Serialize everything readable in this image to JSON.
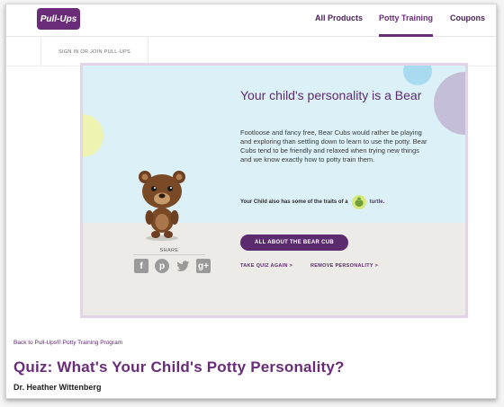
{
  "header": {
    "logo_text": "Pull-Ups",
    "nav": [
      "All Products",
      "Potty Training",
      "Coupons"
    ],
    "active_nav": "Potty Training",
    "signin_label": "SIGN IN OR JOIN PULL-UPS"
  },
  "result": {
    "title": "Your child's personality is a Bear",
    "description": "Footloose and fancy free, Bear Cubs would rather be playing and exploring than settling down to learn to use the potty. Bear Cubs tend to be friendly and relaxed when trying new things and we know exactly how to potty train them.",
    "traits_text": "Your Child also has some of the traits of a",
    "trait_animal": "turtle.",
    "cta_label": "ALL ABOUT THE BEAR CUB",
    "retake_label": "TAKE QUIZ AGAIN >",
    "remove_label": "REMOVE PERSONALITY >"
  },
  "share": {
    "label": "SHARE",
    "icons": [
      "facebook-icon",
      "pinterest-icon",
      "twitter-icon",
      "google-plus-icon"
    ]
  },
  "footer": {
    "back_link": "Back to Pull-Ups® Potty Training Program",
    "page_title": "Quiz: What's Your Child's Potty Personality?",
    "author": "Dr. Heather Wittenberg"
  },
  "colors": {
    "brand_purple": "#6a2c79",
    "card_sky": "#dcf1f7",
    "card_ground": "#ecebe7"
  }
}
